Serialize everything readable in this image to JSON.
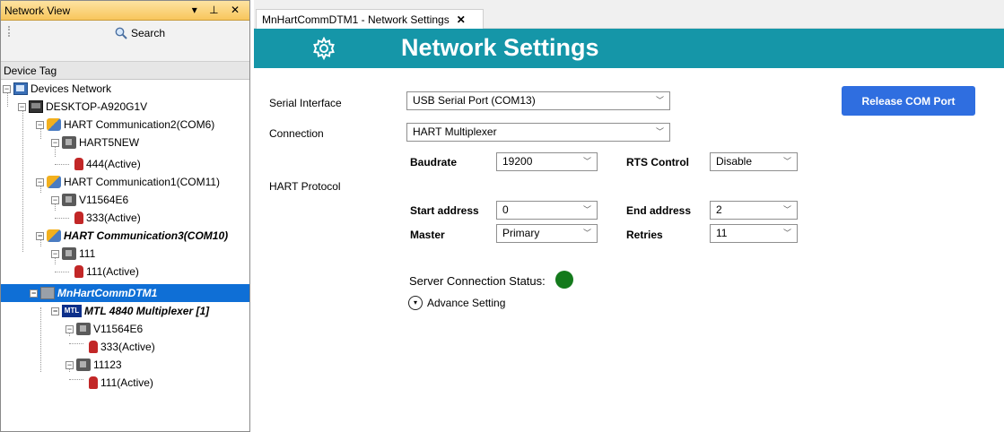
{
  "left_panel": {
    "title": "Network View",
    "controls": "▾ ⊥ ✕",
    "search_label": "Search",
    "column_header": "Device Tag",
    "tree": [
      {
        "label": "Devices Network"
      },
      {
        "label": "DESKTOP-A920G1V"
      },
      {
        "label": "HART Communication2(COM6)"
      },
      {
        "label": "HART5NEW"
      },
      {
        "label": "444(Active)"
      },
      {
        "label": "HART Communication1(COM11)"
      },
      {
        "label": "V11564E6"
      },
      {
        "label": "333(Active)"
      },
      {
        "label": "HART Communication3(COM10)"
      },
      {
        "label": "111"
      },
      {
        "label": "111(Active)"
      },
      {
        "label": "MnHartCommDTM1"
      },
      {
        "label": "MTL 4840 Multiplexer [1]"
      },
      {
        "label": "V11564E6"
      },
      {
        "label": "333(Active)"
      },
      {
        "label": "11123"
      },
      {
        "label": "111(Active)"
      }
    ],
    "mtl_icon_text": "MTL"
  },
  "tab": {
    "label": "MnHartCommDTM1 - Network Settings",
    "close": "✕"
  },
  "banner": {
    "title": "Network Settings"
  },
  "form": {
    "serial_interface_label": "Serial Interface",
    "serial_interface_value": "USB Serial Port (COM13)",
    "connection_label": "Connection",
    "connection_value": "HART Multiplexer",
    "baudrate_label": "Baudrate",
    "baudrate_value": "19200",
    "rts_label": "RTS Control",
    "rts_value": "Disable",
    "hart_protocol_label": "HART Protocol",
    "start_address_label": "Start address",
    "start_address_value": "0",
    "end_address_label": "End address",
    "end_address_value": "2",
    "master_label": "Master",
    "master_value": "Primary",
    "retries_label": "Retries",
    "retries_value": "11",
    "release_button": "Release COM Port",
    "server_status_label": "Server Connection Status:",
    "server_status_color": "#147a1c",
    "advance_setting": "Advance Setting"
  },
  "colors": {
    "banner": "#1596a8",
    "selection": "#0f6fd6",
    "button": "#2f6ee0",
    "panel_header": "#f8c65c"
  }
}
